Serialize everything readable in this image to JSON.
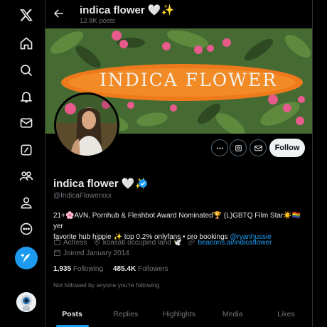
{
  "header": {
    "title": "indica flower 🤍✨",
    "post_count": "12.8K posts"
  },
  "banner": {
    "text": "INDICA FLOWER"
  },
  "profile": {
    "name": "indica flower 🤍✨",
    "handle": "@IndicaFlowerxxx",
    "bio_line1": "21+🌸AVN, Pornhub & Fleshbot Award Nominated🏆 (L)GBTQ Film Star☀️🏳️‍🌈 yer",
    "bio_line2_text": "favorite hub hippie ✨ top 0.2% onlyfans • pro bookings ",
    "bio_link": "@ryanhussie",
    "category": "Actress",
    "location": "koasati occupied land 🕊️",
    "website": "beacons.ai/indicaflower",
    "joined": "Joined January 2014",
    "following_count": "1,935",
    "following_label": "Following",
    "followers_count": "485.4K",
    "followers_label": "Followers",
    "not_followed": "Not followed by anyone you’re following"
  },
  "buttons": {
    "follow": "Follow"
  },
  "tabs": [
    "Posts",
    "Replies",
    "Highlights",
    "Media",
    "Likes"
  ],
  "icons": [
    "x-logo-icon",
    "home-icon",
    "search-icon",
    "notifications-icon",
    "messages-icon",
    "grok-icon",
    "communities-icon",
    "profile-icon",
    "more-icon",
    "compose-icon"
  ],
  "colors": {
    "accent": "#1d9bf0",
    "background": "#000000",
    "muted": "#71767b"
  }
}
